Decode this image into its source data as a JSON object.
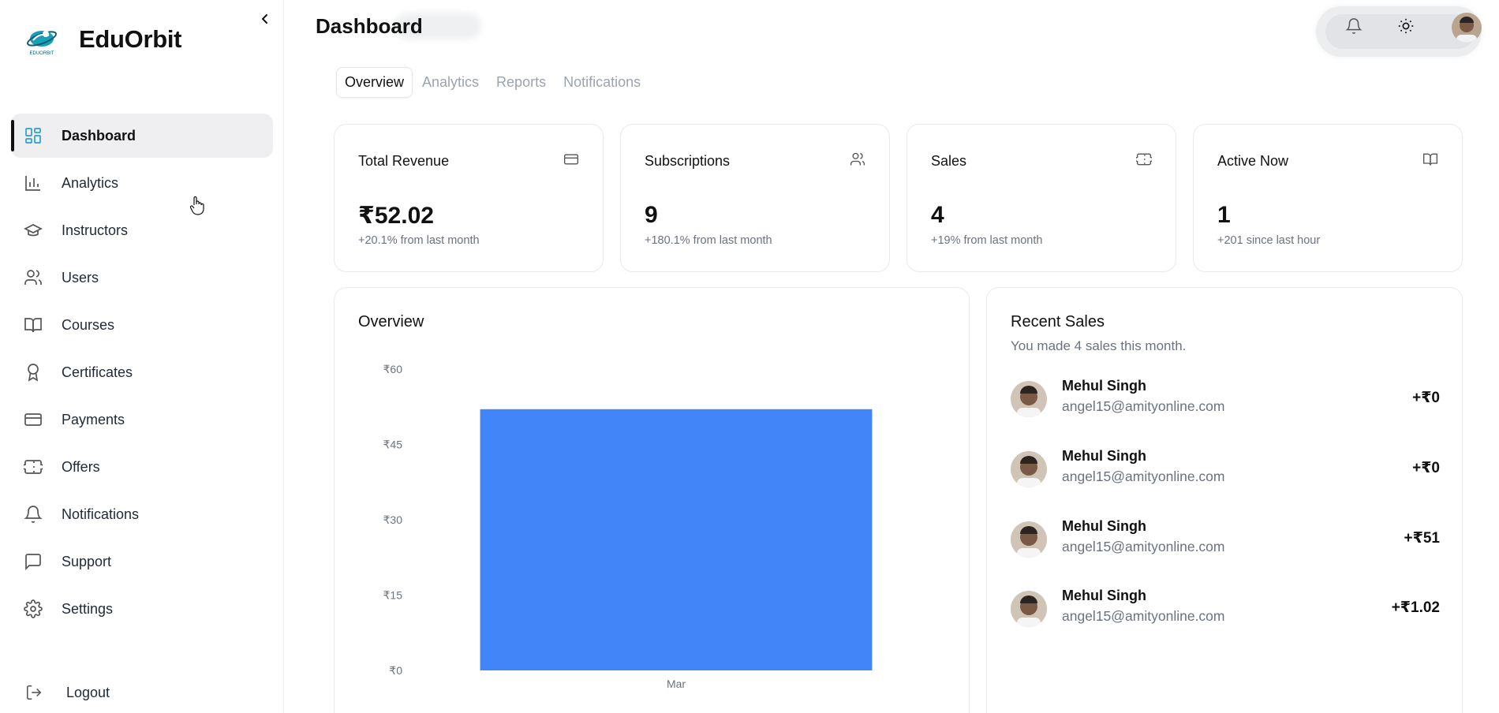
{
  "brand": {
    "name": "EduOrbit",
    "logo_text": "EDUORBIT"
  },
  "sidebar": {
    "items": [
      {
        "label": "Dashboard",
        "icon": "layout-grid-icon",
        "active": true
      },
      {
        "label": "Analytics",
        "icon": "bar-chart-icon"
      },
      {
        "label": "Instructors",
        "icon": "graduation-cap-icon"
      },
      {
        "label": "Users",
        "icon": "users-icon"
      },
      {
        "label": "Courses",
        "icon": "book-open-icon"
      },
      {
        "label": "Certificates",
        "icon": "award-icon"
      },
      {
        "label": "Payments",
        "icon": "credit-card-icon"
      },
      {
        "label": "Offers",
        "icon": "ticket-icon"
      },
      {
        "label": "Notifications",
        "icon": "bell-icon"
      },
      {
        "label": "Support",
        "icon": "message-square-icon"
      },
      {
        "label": "Settings",
        "icon": "gear-icon"
      }
    ],
    "logout_label": "Logout"
  },
  "header": {
    "title": "Dashboard"
  },
  "tabs": [
    {
      "label": "Overview",
      "active": true
    },
    {
      "label": "Analytics"
    },
    {
      "label": "Reports"
    },
    {
      "label": "Notifications"
    }
  ],
  "stats": [
    {
      "label": "Total Revenue",
      "value": "₹52.02",
      "sub": "+20.1% from last month",
      "icon": "credit-card-icon"
    },
    {
      "label": "Subscriptions",
      "value": "9",
      "sub": "+180.1% from last month",
      "icon": "users-icon"
    },
    {
      "label": "Sales",
      "value": "4",
      "sub": "+19% from last month",
      "icon": "ticket-icon"
    },
    {
      "label": "Active Now",
      "value": "1",
      "sub": "+201 since last hour",
      "icon": "book-open-icon"
    }
  ],
  "overview": {
    "title": "Overview"
  },
  "chart_data": {
    "type": "bar",
    "categories": [
      "Mar"
    ],
    "values": [
      52.02
    ],
    "ylim": [
      0,
      60
    ],
    "yticks": [
      0,
      15,
      30,
      45,
      60
    ],
    "ytick_labels": [
      "₹0",
      "₹15",
      "₹30",
      "₹45",
      "₹60"
    ],
    "xtick_labels": [
      "Mar"
    ],
    "bar_color": "#4285f8",
    "grid": false
  },
  "recent_sales": {
    "title": "Recent Sales",
    "subtitle": "You made 4 sales this month.",
    "items": [
      {
        "name": "Mehul Singh",
        "email": "angel15@amityonline.com",
        "amount": "+₹0"
      },
      {
        "name": "Mehul Singh",
        "email": "angel15@amityonline.com",
        "amount": "+₹0"
      },
      {
        "name": "Mehul Singh",
        "email": "angel15@amityonline.com",
        "amount": "+₹51"
      },
      {
        "name": "Mehul Singh",
        "email": "angel15@amityonline.com",
        "amount": "+₹1.02"
      }
    ]
  },
  "colors": {
    "accent": "#4285f8",
    "active_nav_bg": "#efeff1",
    "text": "#111827",
    "muted": "#6b7280"
  }
}
